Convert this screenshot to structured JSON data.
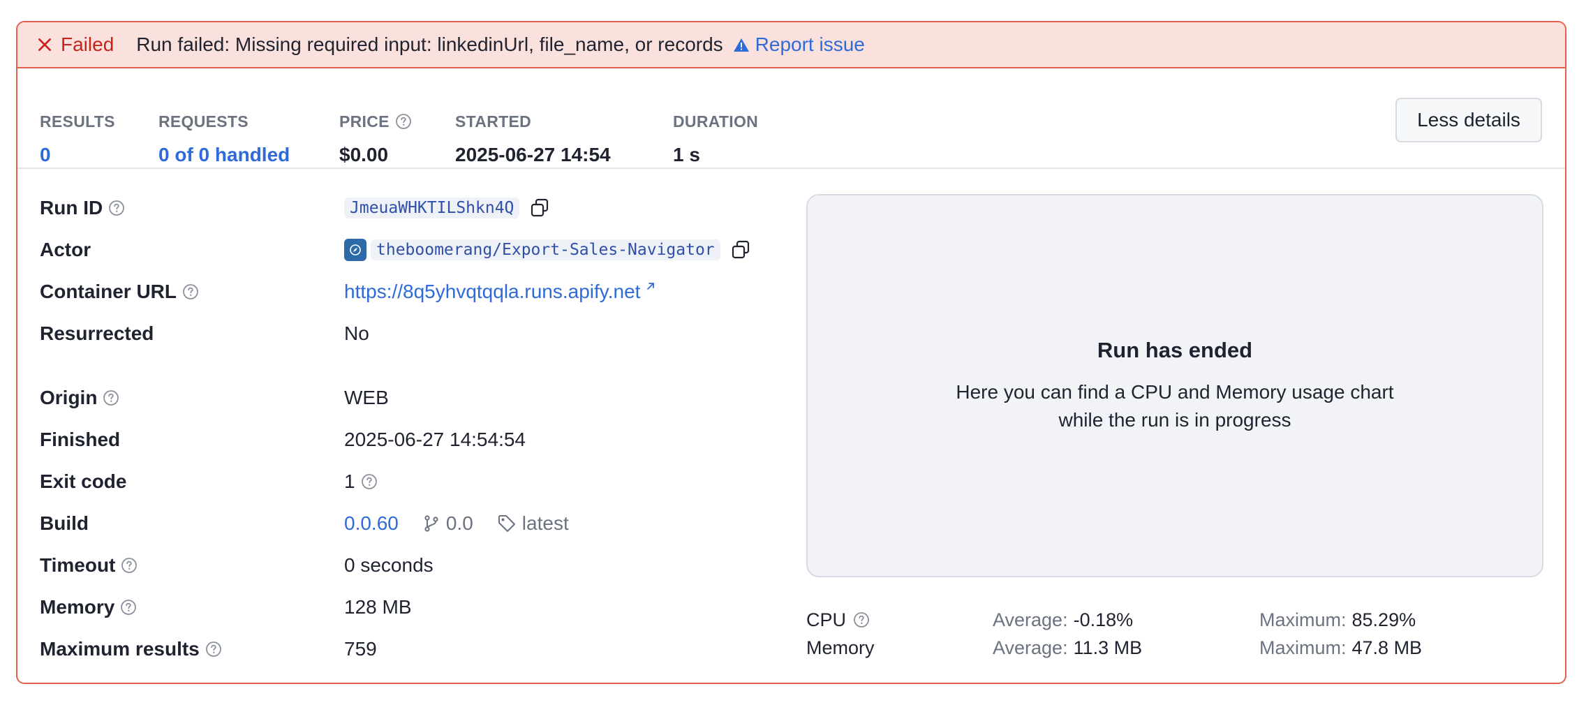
{
  "banner": {
    "status": "Failed",
    "message": "Run failed: Missing required input: linkedinUrl, file_name, or records",
    "report_label": "Report issue"
  },
  "stats": {
    "results_label": "RESULTS",
    "results_value": "0",
    "requests_label": "REQUESTS",
    "requests_value": "0 of 0 handled",
    "price_label": "PRICE",
    "price_value": "$0.00",
    "started_label": "STARTED",
    "started_value": "2025-06-27 14:54",
    "duration_label": "DURATION",
    "duration_value": "1 s",
    "less_details_label": "Less details"
  },
  "details": {
    "run_id_label": "Run ID",
    "run_id": "JmeuaWHKTILShkn4Q",
    "actor_label": "Actor",
    "actor": "theboomerang/Export-Sales-Navigator",
    "container_url_label": "Container URL",
    "container_url": "https://8q5yhvqtqqla.runs.apify.net",
    "resurrected_label": "Resurrected",
    "resurrected": "No",
    "origin_label": "Origin",
    "origin": "WEB",
    "finished_label": "Finished",
    "finished": "2025-06-27 14:54:54",
    "exit_code_label": "Exit code",
    "exit_code": "1",
    "build_label": "Build",
    "build": "0.0.60",
    "build_version": "0.0",
    "build_tag": "latest",
    "timeout_label": "Timeout",
    "timeout": "0 seconds",
    "memory_label": "Memory",
    "memory": "128 MB",
    "max_results_label": "Maximum results",
    "max_results": "759"
  },
  "chart_placeholder": {
    "title": "Run has ended",
    "description": "Here you can find a CPU and Memory usage chart while the run is in progress"
  },
  "usage": {
    "cpu_label": "CPU",
    "memory_label": "Memory",
    "average_label": "Average:",
    "maximum_label": "Maximum:",
    "cpu_average": "-0.18%",
    "cpu_maximum": "85.29%",
    "memory_average": "11.3 MB",
    "memory_maximum": "47.8 MB"
  },
  "colors": {
    "failed": "#c7231b",
    "banner_bg": "#fbe1dd",
    "border": "#e5604a",
    "link": "#2f6ad9"
  }
}
